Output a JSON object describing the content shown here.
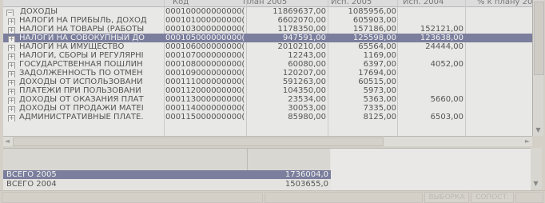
{
  "grid": {
    "columns": [
      "Код",
      "План 2005",
      "Исп. 2005",
      "Исп. 2004",
      "% к плану 20"
    ],
    "rows": [
      {
        "name": "ДОХОДЫ",
        "code": "000100000000000(",
        "plan2005": "11869637,00",
        "isp2005": "1085956,00",
        "isp2004": "",
        "level": 0
      },
      {
        "name": "НАЛОГИ НА ПРИБЫЛЬ, ДОХОД",
        "code": "000101000000000(",
        "plan2005": "6602070,00",
        "isp2005": "605903,00",
        "isp2004": "",
        "level": 1
      },
      {
        "name": "НАЛОГИ НА ТОВАРЫ (РАБОТЫ",
        "code": "000103000000000(",
        "plan2005": "1178350,00",
        "isp2005": "157186,00",
        "isp2004": "152121,00",
        "level": 1
      },
      {
        "name": "НАЛОГИ НА СОВОКУПНЫЙ ДО",
        "code": "000105000000000(",
        "plan2005": "947591,00",
        "isp2005": "125598,00",
        "isp2004": "123638,00",
        "level": 1,
        "selected": true
      },
      {
        "name": "НАЛОГИ НА ИМУЩЕСТВО",
        "code": "000106000000000(",
        "plan2005": "2010210,00",
        "isp2005": "65564,00",
        "isp2004": "24444,00",
        "level": 1
      },
      {
        "name": "НАЛОГИ, СБОРЫ И РЕГУЛЯРНІ",
        "code": "000107000000000(",
        "plan2005": "12243,00",
        "isp2005": "1169,00",
        "isp2004": "",
        "level": 1
      },
      {
        "name": "ГОСУДАРСТВЕННАЯ ПОШЛИН",
        "code": "000108000000000(",
        "plan2005": "60080,00",
        "isp2005": "6397,00",
        "isp2004": "4052,00",
        "level": 1
      },
      {
        "name": "ЗАДОЛЖЕННОСТЬ ПО ОТМЕН",
        "code": "000109000000000(",
        "plan2005": "120207,00",
        "isp2005": "17694,00",
        "isp2004": "",
        "level": 1
      },
      {
        "name": "ДОХОДЫ ОТ ИСПОЛЬЗОВАНИ",
        "code": "000111000000000(",
        "plan2005": "591263,00",
        "isp2005": "60515,00",
        "isp2004": "",
        "level": 1
      },
      {
        "name": "ПЛАТЕЖИ ПРИ ПОЛЬЗОВАНИ",
        "code": "000112000000000(",
        "plan2005": "104350,00",
        "isp2005": "5973,00",
        "isp2004": "",
        "level": 1
      },
      {
        "name": "ДОХОДЫ ОТ ОКАЗАНИЯ ПЛАТ",
        "code": "000113000000000(",
        "plan2005": "23534,00",
        "isp2005": "5363,00",
        "isp2004": "5660,00",
        "level": 1
      },
      {
        "name": "ДОХОДЫ ОТ ПРОДАЖИ МАТЕІ",
        "code": "000114000000000(",
        "plan2005": "30053,00",
        "isp2005": "7335,00",
        "isp2004": "",
        "level": 1
      },
      {
        "name": "АДМИНИСТРАТИВНЫЕ ПЛАТЕ.",
        "code": "000115000000000(",
        "plan2005": "85980,00",
        "isp2005": "8125,00",
        "isp2004": "6503,00",
        "level": 1
      }
    ]
  },
  "summary": {
    "rows": [
      {
        "label": "ВСЕГО 2005",
        "value": "1736004,0",
        "selected": true
      },
      {
        "label": "ВСЕГО 2004",
        "value": "1503655,0"
      }
    ]
  },
  "status": {
    "buttons": [
      "ВЫБОРКА",
      "СОПОСТ."
    ]
  },
  "icons": {
    "expand": "⊞",
    "collapse": "⊟",
    "scroll_up": "▲",
    "scroll_down": "▼",
    "scroll_left": "◄",
    "scroll_right": "►"
  }
}
